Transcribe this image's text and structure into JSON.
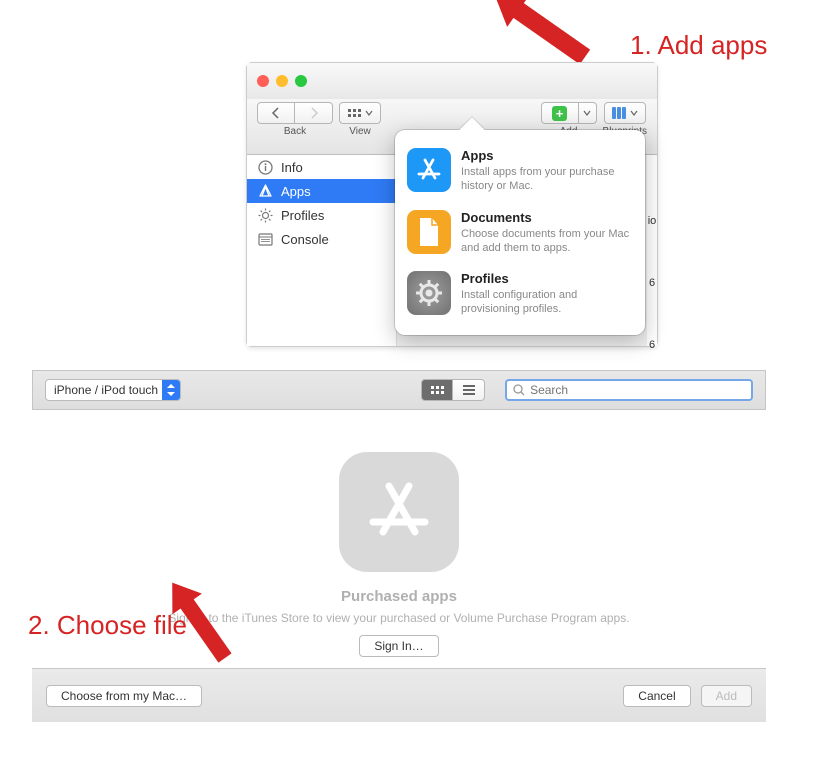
{
  "annotations": {
    "step1": "1. Add apps",
    "step2": "2. Choose file"
  },
  "window": {
    "toolbar": {
      "back_label": "Back",
      "view_label": "View",
      "add_label": "Add",
      "blueprints_label": "Blueprints"
    },
    "sidebar": {
      "items": [
        {
          "label": "Info"
        },
        {
          "label": "Apps"
        },
        {
          "label": "Profiles"
        },
        {
          "label": "Console"
        }
      ]
    }
  },
  "popover": {
    "items": [
      {
        "title": "Apps",
        "desc": "Install apps from your purchase history or Mac."
      },
      {
        "title": "Documents",
        "desc": "Choose documents from your Mac and add them to apps."
      },
      {
        "title": "Profiles",
        "desc": "Install configuration and provisioning profiles."
      }
    ]
  },
  "chooser": {
    "device_select": "iPhone / iPod touch",
    "search_placeholder": "Search",
    "empty_title": "Purchased apps",
    "empty_desc": "Sign in to the iTunes Store to view your purchased or Volume Purchase Program apps.",
    "sign_in_label": "Sign In…",
    "choose_label": "Choose from my Mac…",
    "cancel_label": "Cancel",
    "add_label": "Add"
  }
}
